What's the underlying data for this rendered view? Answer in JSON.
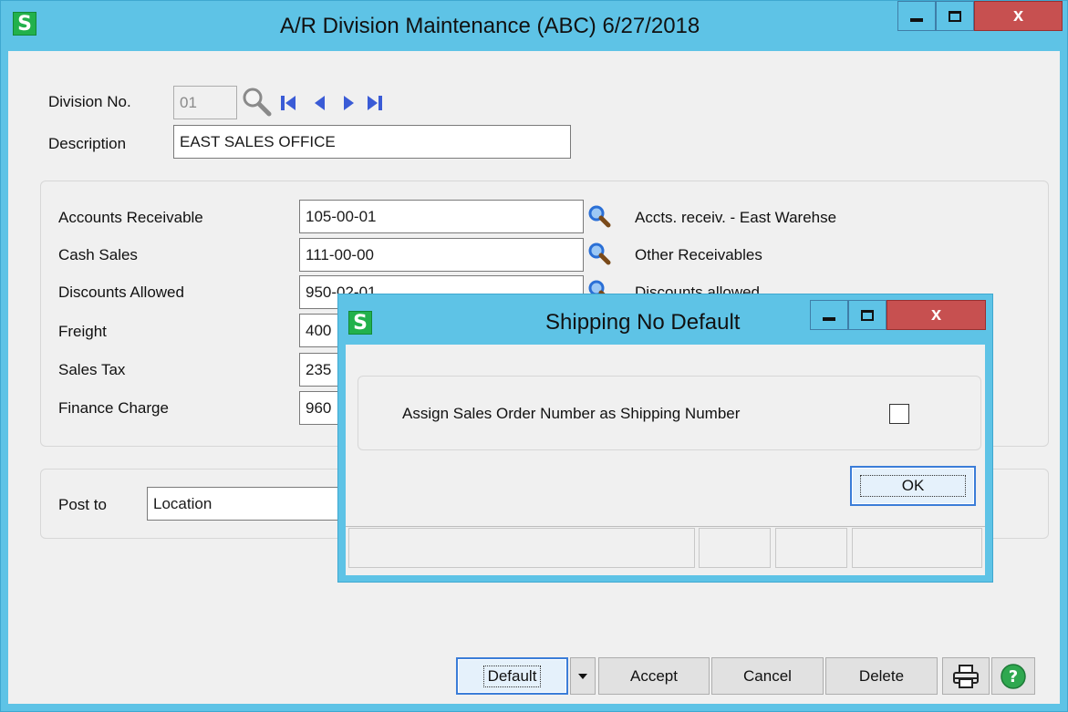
{
  "window": {
    "app_icon_letter": "S",
    "title": "A/R Division Maintenance (ABC) 6/27/2018",
    "close_glyph": "x"
  },
  "header": {
    "division_label": "Division No.",
    "division_value": "01",
    "description_label": "Description",
    "description_value": "EAST SALES OFFICE"
  },
  "accounts": {
    "rows": [
      {
        "label": "Accounts Receivable",
        "value": "105-00-01",
        "description": "Accts. receiv. - East Warehse"
      },
      {
        "label": "Cash Sales",
        "value": "111-00-00",
        "description": "Other Receivables"
      },
      {
        "label": "Discounts Allowed",
        "value": "950-02-01",
        "description": "Discounts allowed"
      },
      {
        "label": "Freight",
        "value": "400",
        "description": ""
      },
      {
        "label": "Sales Tax",
        "value": "235",
        "description": ""
      },
      {
        "label": "Finance Charge",
        "value": "960",
        "description": ""
      }
    ]
  },
  "post_to": {
    "label": "Post to",
    "value": "Location"
  },
  "buttons": {
    "default": "Default",
    "accept": "Accept",
    "cancel": "Cancel",
    "delete": "Delete"
  },
  "dialog": {
    "app_icon_letter": "S",
    "title": "Shipping No Default",
    "close_glyph": "x",
    "checkbox_label": "Assign Sales Order Number as Shipping Number",
    "checkbox_checked": false,
    "ok_label": "OK"
  },
  "colors": {
    "title_bar": "#5ec3e6",
    "close_button": "#c75050",
    "app_icon": "#22b14c",
    "lookup_icon": "#2a6fd6",
    "nav_arrows": "#3a5bd6",
    "help_icon": "#2fa84f"
  },
  "icons": {
    "lookup": "magnifier-icon",
    "first": "first-record-icon",
    "previous": "previous-record-icon",
    "next": "next-record-icon",
    "last": "last-record-icon",
    "dropdown": "dropdown-arrow-icon",
    "print": "printer-icon",
    "help": "help-icon"
  }
}
